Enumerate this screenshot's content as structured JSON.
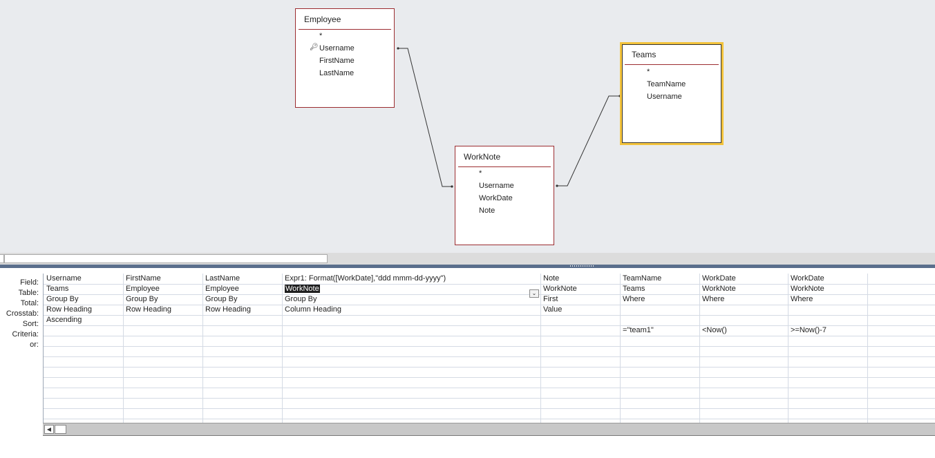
{
  "tables": {
    "employee": {
      "title": "Employee",
      "fields": [
        "*",
        "Username",
        "FirstName",
        "LastName"
      ]
    },
    "teams": {
      "title": "Teams",
      "fields": [
        "*",
        "TeamName",
        "Username"
      ]
    },
    "worknote": {
      "title": "WorkNote",
      "fields": [
        "*",
        "Username",
        "WorkDate",
        "Note"
      ]
    }
  },
  "icons": {
    "key_icon": "key-icon",
    "dropdown": "chevron-down-icon",
    "scroll_left": "arrow-left-icon"
  },
  "row_labels": [
    "Field:",
    "Table:",
    "Total:",
    "Crosstab:",
    "Sort:",
    "Criteria:",
    "or:"
  ],
  "grid": {
    "columns": [
      {
        "field": "Username",
        "table": "Teams",
        "total": "Group By",
        "crosstab": "Row Heading",
        "sort": "Ascending",
        "criteria": "",
        "or": ""
      },
      {
        "field": "FirstName",
        "table": "Employee",
        "total": "Group By",
        "crosstab": "Row Heading",
        "sort": "",
        "criteria": "",
        "or": ""
      },
      {
        "field": "LastName",
        "table": "Employee",
        "total": "Group By",
        "crosstab": "Row Heading",
        "sort": "",
        "criteria": "",
        "or": ""
      },
      {
        "field": "Expr1: Format([WorkDate],\"ddd  mmm-dd-yyyy\")",
        "table": "WorkNote",
        "total": "Group By",
        "crosstab": "Column Heading",
        "sort": "",
        "criteria": "",
        "or": ""
      },
      {
        "field": "Note",
        "table": "WorkNote",
        "total": "First",
        "crosstab": "Value",
        "sort": "",
        "criteria": "",
        "or": ""
      },
      {
        "field": "TeamName",
        "table": "Teams",
        "total": "Where",
        "crosstab": "",
        "sort": "",
        "criteria": "=\"team1\"",
        "or": ""
      },
      {
        "field": "WorkDate",
        "table": "WorkNote",
        "total": "Where",
        "crosstab": "",
        "sort": "",
        "criteria": "<Now()",
        "or": ""
      },
      {
        "field": "WorkDate",
        "table": "WorkNote",
        "total": "Where",
        "crosstab": "",
        "sort": "",
        "criteria": ">=Now()-7",
        "or": ""
      }
    ]
  }
}
